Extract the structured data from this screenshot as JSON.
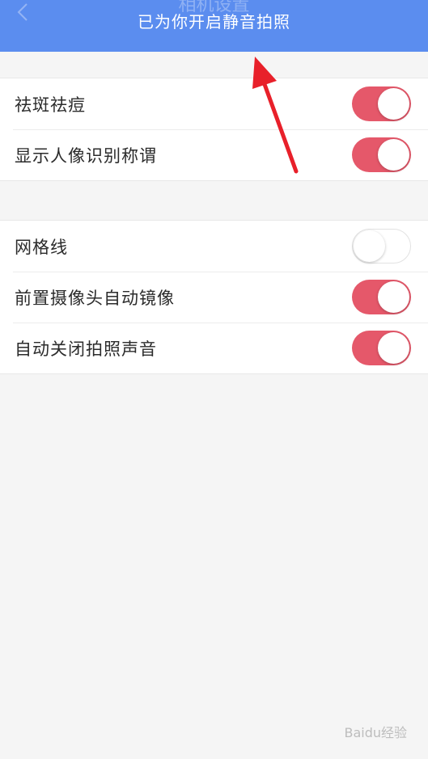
{
  "header": {
    "page_title": "相机设置",
    "toast": "已为你开启静音拍照"
  },
  "groups": [
    {
      "items": [
        {
          "label": "祛斑祛痘",
          "enabled": true
        },
        {
          "label": "显示人像识别称谓",
          "enabled": true
        }
      ]
    },
    {
      "items": [
        {
          "label": "网格线",
          "enabled": false
        },
        {
          "label": "前置摄像头自动镜像",
          "enabled": true
        },
        {
          "label": "自动关闭拍照声音",
          "enabled": true
        }
      ]
    }
  ],
  "colors": {
    "toast_bg": "#5b8def",
    "switch_on": "#e5586a",
    "page_bg": "#f5f5f5",
    "annotation_arrow": "#e8202a"
  },
  "icons": {
    "back": "chevron-left-icon",
    "annotation": "red-arrow-icon"
  },
  "watermark": {
    "text": "Baidu经验"
  }
}
